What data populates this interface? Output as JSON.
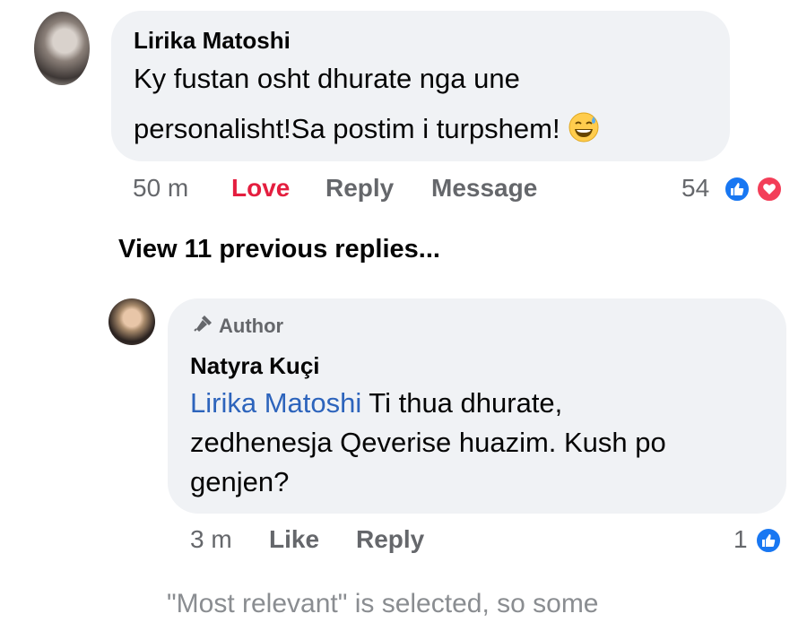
{
  "comment": {
    "author": "Lirika Matoshi",
    "text_line1": "Ky fustan osht dhurate nga une",
    "text_line2": "personalisht!Sa postim i turpshem!",
    "emoji": "grinning-sweat-emoji",
    "time": "50 m",
    "actions": {
      "love": "Love",
      "reply": "Reply",
      "message": "Message"
    },
    "reaction_count": "54",
    "reactions": [
      "like-icon",
      "heart-icon"
    ]
  },
  "view_previous": "View 11 previous replies...",
  "reply": {
    "badge": "Author",
    "author": "Natyra Kuçi",
    "mention": "Lirika Matoshi",
    "text_line1_rest": " Ti thua dhurate,",
    "text_line2": "zedhenesja Qeverise huazim. Kush po",
    "text_line3": "genjen?",
    "time": "3 m",
    "actions": {
      "like": "Like",
      "reply": "Reply"
    },
    "reaction_count": "1",
    "reactions": [
      "like-icon"
    ]
  },
  "footer_note": "\"Most relevant\" is selected, so some",
  "colors": {
    "love": "#e41e3f",
    "mention": "#2d64bc",
    "like": "#1877f2",
    "heart": "#f33e58",
    "bubble": "#f0f2f5"
  }
}
